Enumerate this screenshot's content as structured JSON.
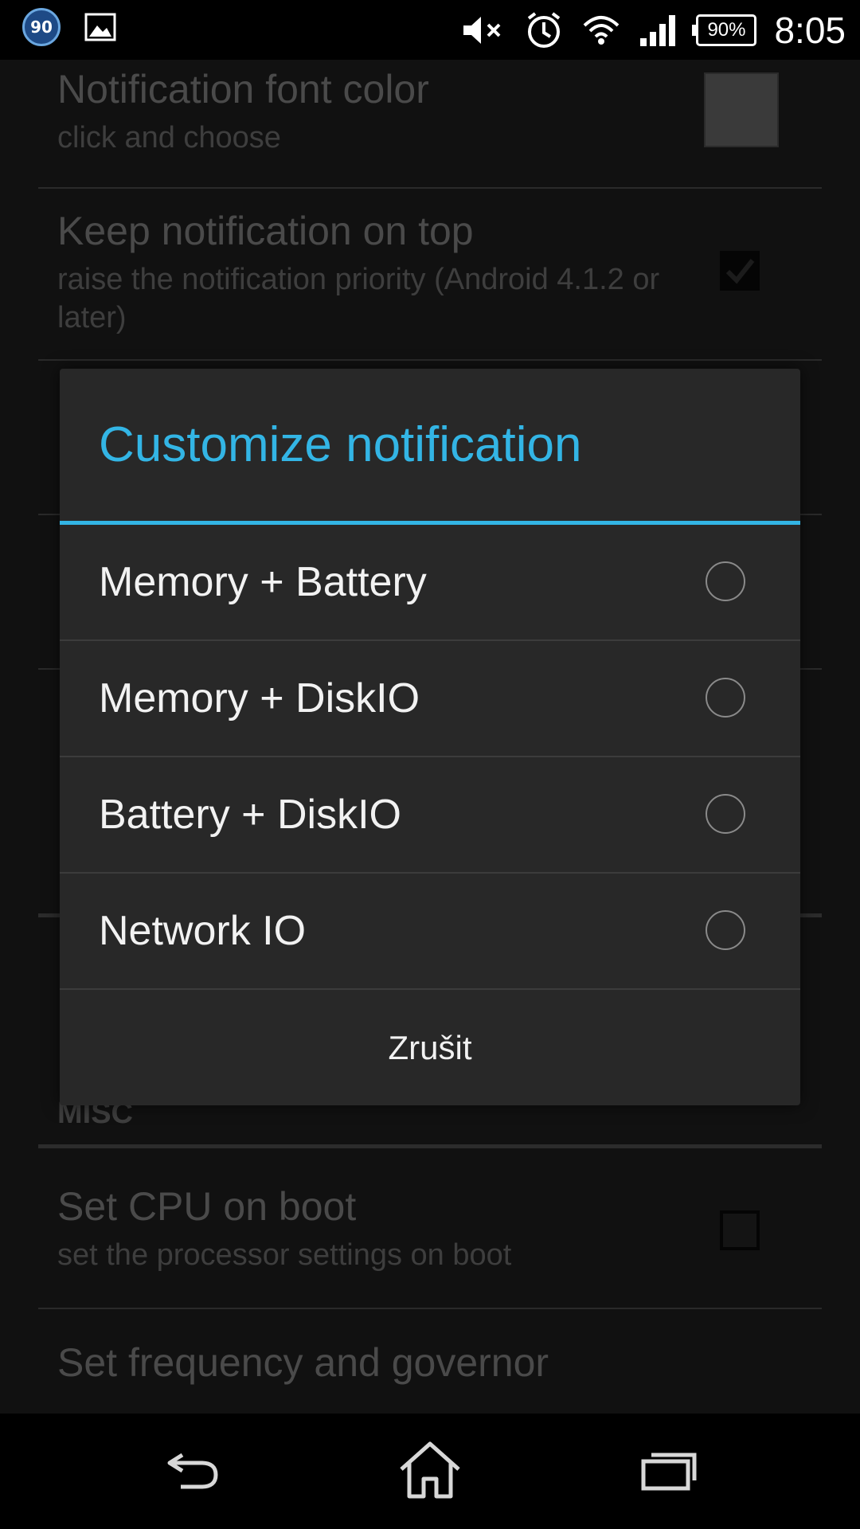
{
  "status_bar": {
    "badge_text": "90",
    "battery_text": "90%",
    "time": "8:05",
    "icons": [
      "badge-icon",
      "image-icon",
      "mute-icon",
      "alarm-icon",
      "wifi-icon",
      "signal-icon",
      "battery-icon"
    ]
  },
  "background": {
    "prefs": [
      {
        "title": "Notification font color",
        "subtitle": "click and choose"
      },
      {
        "title": "Keep notification on top",
        "subtitle": "raise the notification priority (Android 4.1.2 or later)",
        "checked": true
      },
      {
        "title": "Set CPU on boot",
        "subtitle": "set the processor settings on boot",
        "checked": false
      },
      {
        "title": "Set frequency and governor"
      }
    ],
    "section_misc": "MISC"
  },
  "dialog": {
    "title": "Customize notification",
    "options": [
      {
        "label": "Memory + Battery",
        "selected": false
      },
      {
        "label": "Memory + DiskIO",
        "selected": false
      },
      {
        "label": "Battery + DiskIO",
        "selected": false
      },
      {
        "label": "Network IO",
        "selected": false
      }
    ],
    "cancel_label": "Zrušit"
  },
  "colors": {
    "accent": "#33b5e5",
    "dialog_bg": "#282828",
    "text": "#f2f2f2"
  }
}
